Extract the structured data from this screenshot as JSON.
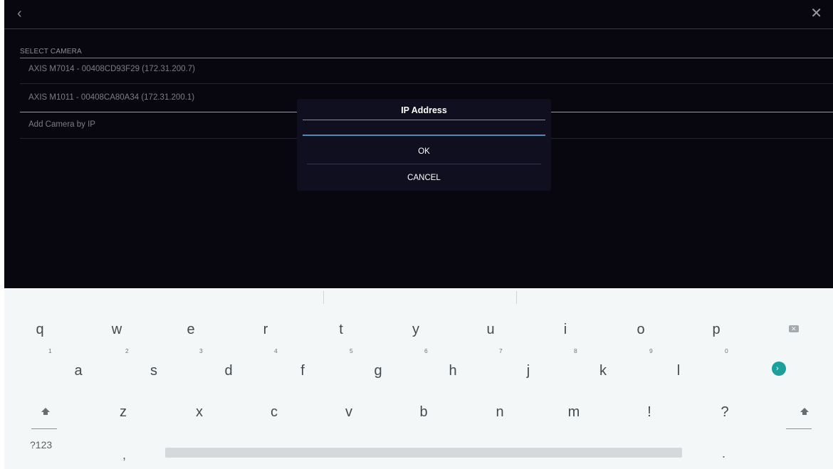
{
  "topbar": {
    "back_glyph": "‹",
    "close_glyph": "✕"
  },
  "camera_list": {
    "section_title": "SELECT CAMERA",
    "items": [
      "AXIS M7014 - 00408CD93F29 (172.31.200.7)",
      "AXIS M1011 - 00408CA80A34 (172.31.200.1)",
      "Add Camera by IP"
    ]
  },
  "dialog": {
    "title": "IP Address",
    "input_value": "",
    "ok_label": "OK",
    "cancel_label": "CANCEL"
  },
  "keyboard": {
    "row1": [
      "q",
      "w",
      "e",
      "r",
      "t",
      "y",
      "u",
      "i",
      "o",
      "p"
    ],
    "row1_hints": [
      "1",
      "2",
      "3",
      "4",
      "5",
      "6",
      "7",
      "8",
      "9",
      "0"
    ],
    "row2": [
      "a",
      "s",
      "d",
      "f",
      "g",
      "h",
      "j",
      "k",
      "l"
    ],
    "row3": [
      "z",
      "x",
      "c",
      "v",
      "b",
      "n",
      "m",
      "!",
      "?"
    ],
    "symbols_label": "?123",
    "comma": ",",
    "period": "."
  },
  "colors": {
    "background": "#08070f",
    "dialog": "#100f1f",
    "input_underline": "#4c8ab8",
    "enter_key": "#1ca09c",
    "keyboard": "#f3f7f7"
  }
}
